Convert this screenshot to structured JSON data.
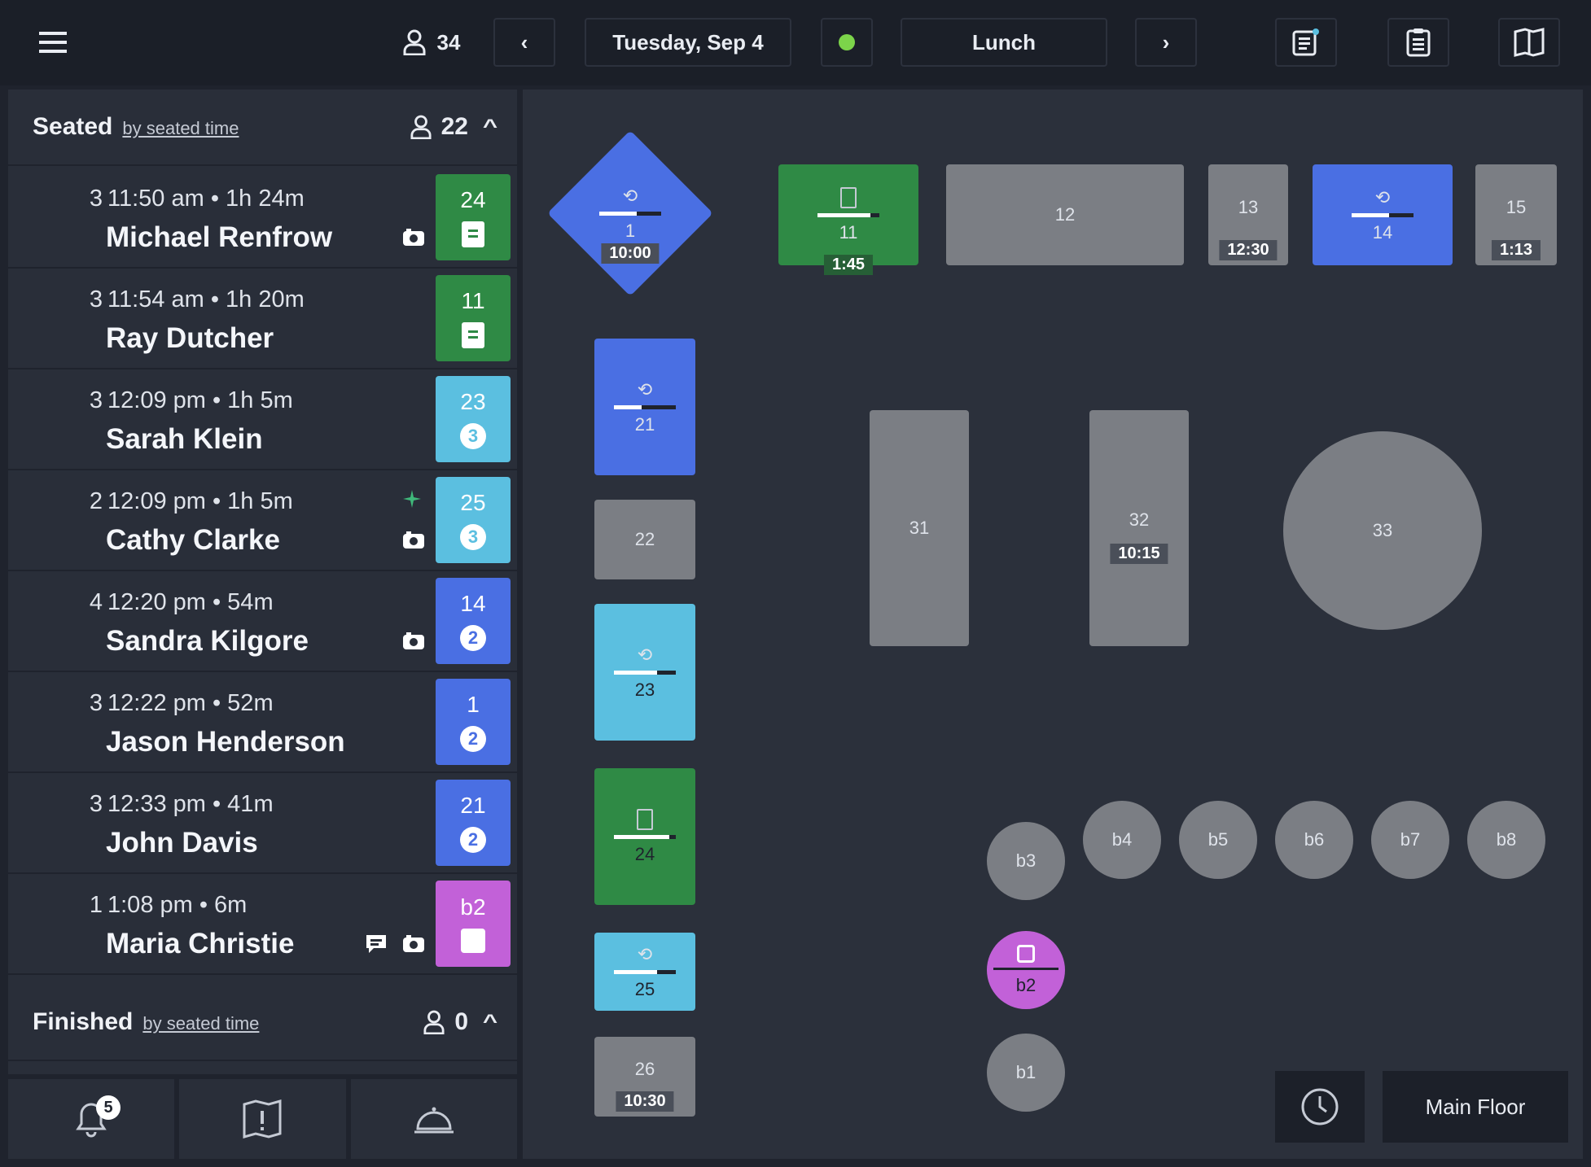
{
  "header": {
    "guest_count": "34",
    "date": "Tuesday, Sep 4",
    "service": "Lunch",
    "status_color": "#7cd44a"
  },
  "seated": {
    "title": "Seated",
    "sort": "by seated time",
    "count": "22",
    "rows": [
      {
        "party": "3",
        "time": "11:50 am • 1h 24m",
        "name": "Michael Renfrow",
        "table": "24",
        "color": "#2f8a45",
        "status": "doc",
        "icons": [
          "camera"
        ]
      },
      {
        "party": "3",
        "time": "11:54 am • 1h 20m",
        "name": "Ray Dutcher",
        "table": "11",
        "color": "#2f8a45",
        "status": "doc",
        "icons": []
      },
      {
        "party": "3",
        "time": "12:09 pm • 1h 5m",
        "name": "Sarah Klein",
        "table": "23",
        "color": "#5bbfe0",
        "status": "3",
        "icons": []
      },
      {
        "party": "2",
        "time": "12:09 pm • 1h 5m",
        "name": "Cathy Clarke",
        "table": "25",
        "color": "#5bbfe0",
        "status": "3",
        "icons": [
          "sparkle",
          "camera"
        ]
      },
      {
        "party": "4",
        "time": "12:20 pm • 54m",
        "name": "Sandra Kilgore",
        "table": "14",
        "color": "#4a6fe3",
        "status": "2",
        "icons": [
          "camera"
        ]
      },
      {
        "party": "3",
        "time": "12:22 pm • 52m",
        "name": "Jason Henderson",
        "table": "1",
        "color": "#4a6fe3",
        "status": "2",
        "icons": []
      },
      {
        "party": "3",
        "time": "12:33 pm • 41m",
        "name": "John Davis",
        "table": "21",
        "color": "#4a6fe3",
        "status": "2",
        "icons": []
      },
      {
        "party": "1",
        "time": "1:08 pm • 6m",
        "name": "Maria Christie",
        "table": "b2",
        "color": "#c261d8",
        "status": "chair",
        "icons": [
          "chat",
          "camera"
        ]
      }
    ]
  },
  "finished": {
    "title": "Finished",
    "sort": "by seated time",
    "count": "0"
  },
  "bottom": {
    "notifications_badge": "5"
  },
  "floor": {
    "name": "Main Floor",
    "tables": {
      "t1": {
        "label": "1",
        "time": "10:00",
        "color": "#4a6fe3",
        "course": "2",
        "progress": 0.6
      },
      "t11": {
        "label": "11",
        "time": "1:45",
        "color": "#2f8a45",
        "progress": 0.85
      },
      "t12": {
        "label": "12",
        "color": "#7b7e84"
      },
      "t13": {
        "label": "13",
        "time": "12:30",
        "color": "#7b7e84"
      },
      "t14": {
        "label": "14",
        "color": "#4a6fe3",
        "course": "2",
        "progress": 0.6
      },
      "t15": {
        "label": "15",
        "time": "1:13",
        "color": "#7b7e84"
      },
      "t21": {
        "label": "21",
        "color": "#4a6fe3",
        "course": "2",
        "progress": 0.45
      },
      "t22": {
        "label": "22",
        "color": "#7b7e84"
      },
      "t23": {
        "label": "23",
        "color": "#5bbfe0",
        "course": "3",
        "progress": 0.7
      },
      "t24": {
        "label": "24",
        "color": "#2f8a45",
        "progress": 0.9
      },
      "t25": {
        "label": "25",
        "color": "#5bbfe0",
        "course": "3",
        "progress": 0.7
      },
      "t26": {
        "label": "26",
        "time": "10:30",
        "color": "#7b7e84"
      },
      "t31": {
        "label": "31",
        "color": "#7b7e84"
      },
      "t32": {
        "label": "32",
        "time": "10:15",
        "color": "#7b7e84"
      },
      "t33": {
        "label": "33",
        "color": "#7b7e84"
      },
      "b1": {
        "label": "b1",
        "color": "#7b7e84"
      },
      "b2": {
        "label": "b2",
        "color": "#c261d8"
      },
      "b3": {
        "label": "b3",
        "color": "#7b7e84"
      },
      "b4": {
        "label": "b4",
        "color": "#7b7e84"
      },
      "b5": {
        "label": "b5",
        "color": "#7b7e84"
      },
      "b6": {
        "label": "b6",
        "color": "#7b7e84"
      },
      "b7": {
        "label": "b7",
        "color": "#7b7e84"
      },
      "b8": {
        "label": "b8",
        "color": "#7b7e84"
      }
    }
  }
}
